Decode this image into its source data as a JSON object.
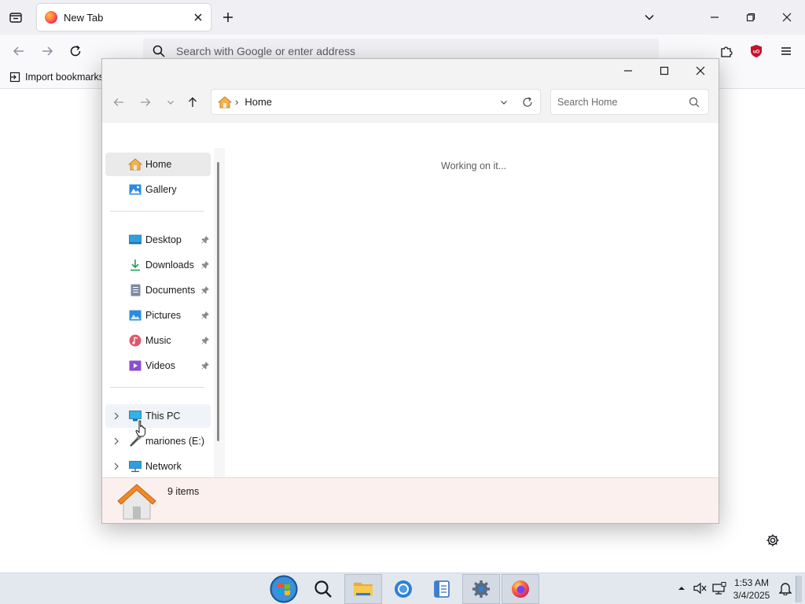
{
  "browser": {
    "tab": {
      "title": "New Tab"
    },
    "urlbar": {
      "placeholder": "Search with Google or enter address"
    },
    "bookmarks": {
      "import_label": "Import bookmarks"
    }
  },
  "explorer": {
    "address": {
      "location": "Home"
    },
    "search": {
      "placeholder": "Search Home"
    },
    "sidebar": {
      "quick": [
        {
          "label": "Home",
          "icon": "home-icon"
        },
        {
          "label": "Gallery",
          "icon": "gallery-icon"
        }
      ],
      "pinned": [
        {
          "label": "Desktop",
          "icon": "desktop-icon"
        },
        {
          "label": "Downloads",
          "icon": "download-icon"
        },
        {
          "label": "Documents",
          "icon": "document-icon"
        },
        {
          "label": "Pictures",
          "icon": "pictures-icon"
        },
        {
          "label": "Music",
          "icon": "music-icon"
        },
        {
          "label": "Videos",
          "icon": "videos-icon"
        }
      ],
      "drives": [
        {
          "label": "This PC",
          "icon": "pc-icon"
        },
        {
          "label": "mariones (E:)",
          "icon": "usb-drive-icon"
        },
        {
          "label": "Network",
          "icon": "network-icon"
        }
      ]
    },
    "content": {
      "status": "Working on it..."
    },
    "details": {
      "count": "9 items"
    }
  },
  "taskbar": {
    "clock": {
      "time": "1:53 AM",
      "date": "3/4/2025"
    },
    "apps": [
      "start-orb-icon",
      "search-icon",
      "file-explorer-icon",
      "chrome-icon",
      "notepad-icon",
      "settings-icon",
      "firefox-icon"
    ]
  },
  "colors": {
    "browser_bg": "#f0f0f4",
    "details_bg": "#fbf0ee",
    "taskbar_bg": "#e3e8ef",
    "ublock_red": "#c4132b"
  }
}
